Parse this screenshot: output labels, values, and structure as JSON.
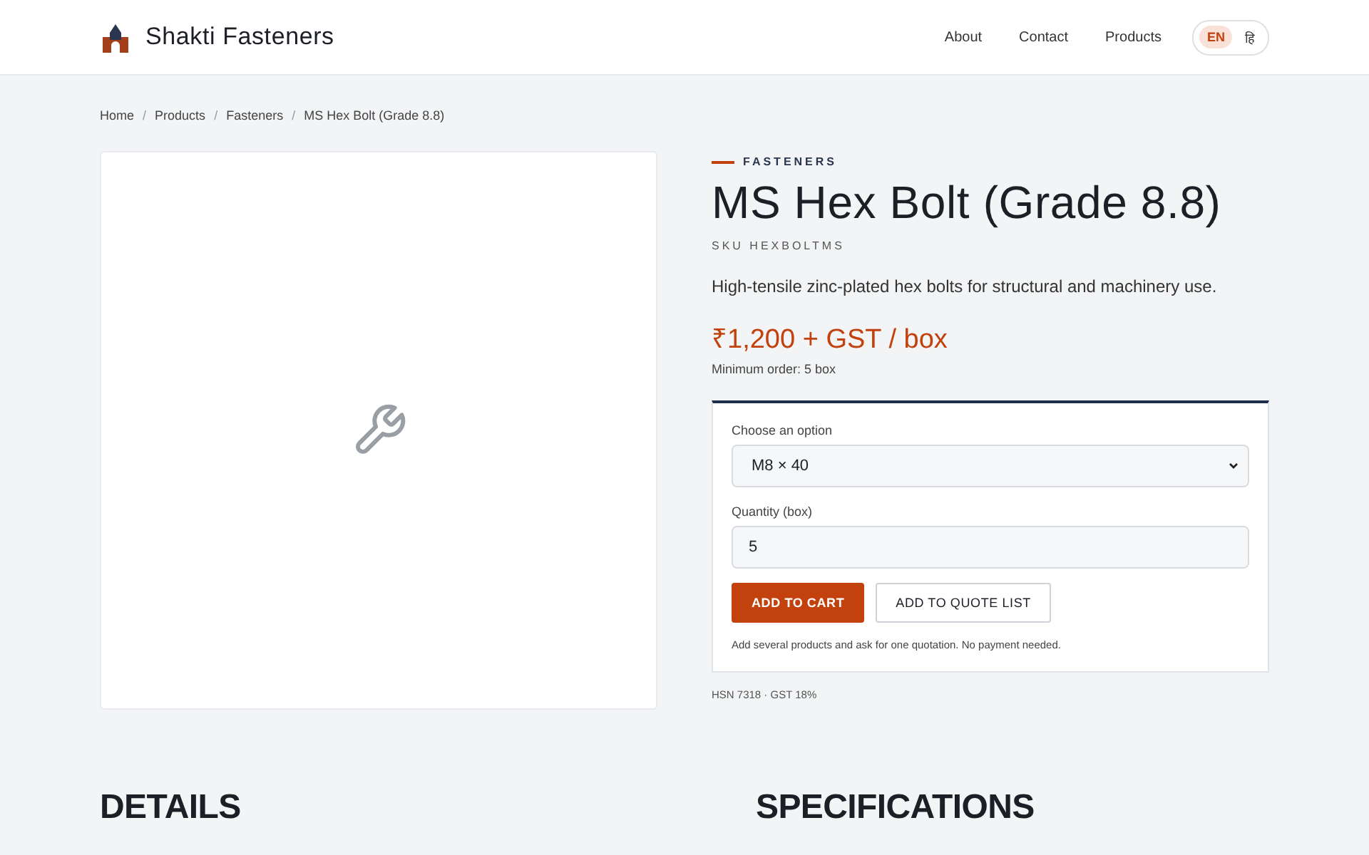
{
  "header": {
    "brand": "Shakti Fasteners",
    "nav": [
      "About",
      "Contact",
      "Products"
    ],
    "languages": [
      {
        "label": "EN",
        "selected": true
      },
      {
        "label": "हि",
        "selected": false
      }
    ]
  },
  "breadcrumb": {
    "items": [
      "Home",
      "Products",
      "Fasteners",
      "MS Hex Bolt (Grade 8.8)"
    ],
    "separators": [
      "/",
      "/",
      "/"
    ]
  },
  "product": {
    "category": "FASTENERS",
    "title": "MS Hex Bolt (Grade 8.8)",
    "sku": "SKU HEXBOLTMS",
    "description": "High-tensile zinc-plated hex bolts for structural and machinery use.",
    "price": "₹1,200 + GST / box",
    "minimum": "Minimum order: 5 box",
    "form": {
      "option_label": "Choose an option",
      "option_value": "M8 × 40",
      "quantity_label": "Quantity (box)",
      "quantity_value": "5",
      "cart_button": "ADD TO CART",
      "quote_button": "ADD TO QUOTE LIST",
      "note": "Add several products and ask for one quotation. No payment needed."
    },
    "tax": "HSN 7318 · GST 18%"
  },
  "sections": [
    "DETAILS",
    "SPECIFICATIONS"
  ]
}
